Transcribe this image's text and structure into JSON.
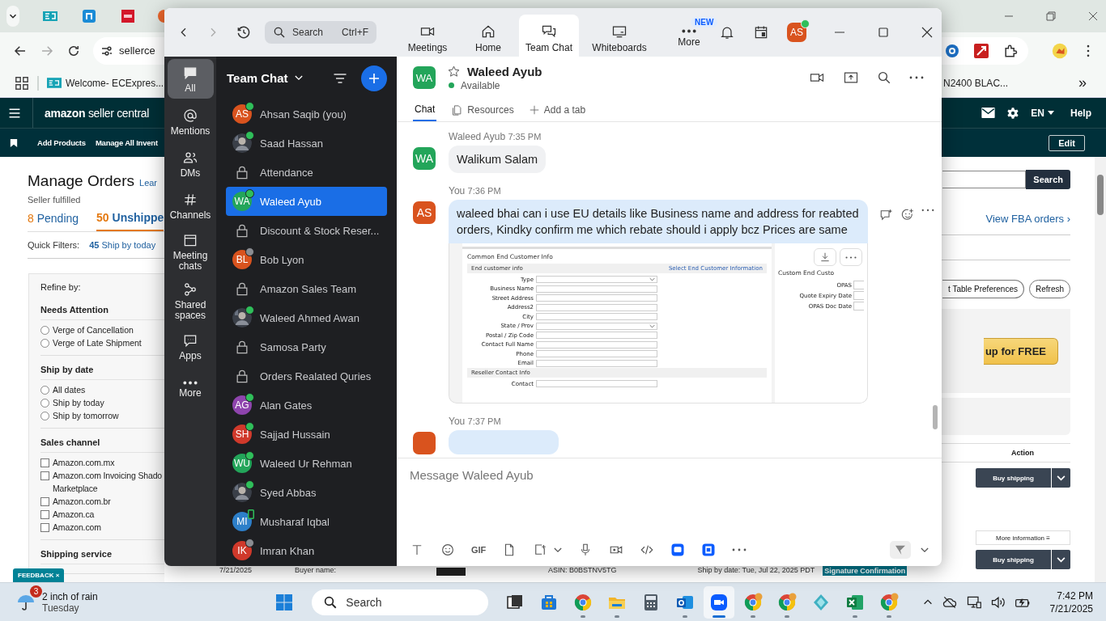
{
  "browser": {
    "address": "sellerce",
    "bookmarks": [
      {
        "label": "Welcome- ECExpres..."
      },
      {
        "label": "N2400 BLAC..."
      }
    ],
    "more_bookmarks": "»"
  },
  "seller_central": {
    "brand": "amazon",
    "product": "seller central",
    "language": "EN",
    "help": "Help",
    "nav": [
      "Add Products",
      "Manage All Invent"
    ],
    "edit": "Edit",
    "title": "Manage Orders",
    "learn": "Lear",
    "subtitle": "Seller fulfilled",
    "status_tabs": [
      {
        "count": "8",
        "label": "Pending",
        "selected": false
      },
      {
        "count": "50",
        "label": "Unshippe",
        "selected": true
      }
    ],
    "quick_filters_label": "Quick Filters:",
    "quick_filters": [
      {
        "count": "45",
        "label": "Ship by today"
      }
    ],
    "refine_title": "Refine by:",
    "refine_groups": [
      {
        "title": "Needs Attention",
        "kind": "radio",
        "options": [
          {
            "label": "Verge of Cancellation",
            "selected": false
          },
          {
            "label": "Verge of Late Shipment",
            "selected": false
          }
        ]
      },
      {
        "title": "Ship by date",
        "kind": "radio",
        "options": [
          {
            "label": "All dates",
            "selected": false
          },
          {
            "label": "Ship by today",
            "selected": false
          },
          {
            "label": "Ship by tomorrow",
            "selected": false
          }
        ]
      },
      {
        "title": "Sales channel",
        "kind": "checkbox",
        "options": [
          {
            "label": "Amazon.com.mx",
            "checked": false
          },
          {
            "label": "Amazon.com Invoicing Shado Marketplace",
            "checked": false
          },
          {
            "label": "Amazon.com.br",
            "checked": false
          },
          {
            "label": "Amazon.ca",
            "checked": false
          },
          {
            "label": "Amazon.com",
            "checked": false
          }
        ]
      },
      {
        "title": "Shipping service",
        "kind": "heading"
      }
    ],
    "search_button": "Search",
    "fba_link": "View FBA orders ›",
    "prefs_button": "t Table Preferences",
    "refresh_button": "Refresh",
    "promo_button": "up for FREE",
    "action_header": "Action",
    "order_actions": [
      {
        "label": "Buy shipping"
      },
      {
        "label": "Buy shipping",
        "more": "More information ≡"
      }
    ],
    "order_row": {
      "date": "7/21/2025",
      "buyer_label": "Buyer name:",
      "asin": "ASIN: B0BSTNV5TG",
      "ship_by": "Ship by date: Tue, Jul 22, 2025 PDT",
      "tag": "Signature Confirmation"
    },
    "feedback": "FEEDBACK ×"
  },
  "zoom": {
    "search": {
      "placeholder": "Search",
      "shortcut": "Ctrl+F"
    },
    "tabs": [
      {
        "label": "Meetings",
        "selected": false
      },
      {
        "label": "Home",
        "selected": false
      },
      {
        "label": "Team Chat",
        "selected": true
      },
      {
        "label": "Whiteboards",
        "selected": false
      },
      {
        "label": "More",
        "selected": false,
        "badge": "NEW"
      }
    ],
    "profile": {
      "initials": "AS",
      "color": "#d9531e",
      "online": true
    },
    "rail": [
      {
        "label": "All",
        "selected": true
      },
      {
        "label": "Mentions",
        "selected": false
      },
      {
        "label": "DMs",
        "selected": false
      },
      {
        "label": "Channels",
        "selected": false
      },
      {
        "label": "Meeting chats",
        "selected": false
      },
      {
        "label": "Shared spaces",
        "selected": false
      },
      {
        "label": "Apps",
        "selected": false
      },
      {
        "label": "More",
        "selected": false
      }
    ],
    "list_title": "Team Chat",
    "chats": [
      {
        "kind": "contact",
        "name": "Ahsan Saqib (you)",
        "initials": "AS",
        "color": "#d9531e",
        "online": true,
        "away": false,
        "mobile": false,
        "selected": false
      },
      {
        "name": "Saad Hassan",
        "online": true,
        "away": false,
        "mobile": false,
        "selected": false
      },
      {
        "kind": "channel",
        "name": "Attendance",
        "online": false,
        "away": false,
        "mobile": false,
        "selected": false
      },
      {
        "kind": "contact",
        "name": "Waleed Ayub",
        "initials": "WA",
        "color": "#23a55a",
        "online": true,
        "away": false,
        "mobile": false,
        "selected": true
      },
      {
        "kind": "channel",
        "name": "Discount & Stock Reser...",
        "online": false,
        "away": false,
        "mobile": false,
        "selected": false
      },
      {
        "kind": "contact",
        "name": "Bob Lyon",
        "initials": "BL",
        "color": "#d9531e",
        "online": false,
        "away": true,
        "mobile": false,
        "selected": false
      },
      {
        "kind": "channel",
        "name": "Amazon Sales Team",
        "online": false,
        "away": false,
        "mobile": false,
        "selected": false
      },
      {
        "name": "Waleed Ahmed Awan",
        "online": true,
        "away": false,
        "mobile": false,
        "selected": false
      },
      {
        "kind": "channel",
        "name": "Samosa Party",
        "online": false,
        "away": false,
        "mobile": false,
        "selected": false
      },
      {
        "kind": "channel",
        "name": "Orders Realated Quries",
        "online": false,
        "away": false,
        "mobile": false,
        "selected": false
      },
      {
        "kind": "contact",
        "name": "Alan Gates",
        "initials": "AG",
        "color": "#8e44ad",
        "online": true,
        "away": false,
        "mobile": false,
        "selected": false
      },
      {
        "kind": "contact",
        "name": "Sajjad Hussain",
        "initials": "SH",
        "color": "#d0392b",
        "online": true,
        "away": false,
        "mobile": false,
        "selected": false
      },
      {
        "kind": "contact",
        "name": "Waleed Ur Rehman",
        "initials": "WU",
        "color": "#23a55a",
        "online": true,
        "away": false,
        "mobile": false,
        "selected": false
      },
      {
        "name": "Syed Abbas",
        "online": true,
        "away": false,
        "mobile": false,
        "selected": false
      },
      {
        "kind": "contact",
        "name": "Musharaf Iqbal",
        "initials": "MI",
        "color": "#2d7fc9",
        "online": false,
        "away": false,
        "mobile": true,
        "selected": false
      },
      {
        "kind": "contact",
        "name": "Imran Khan",
        "initials": "IK",
        "color": "#d0392b",
        "online": false,
        "away": true,
        "mobile": false,
        "selected": false
      }
    ],
    "conversation": {
      "initials": "WA",
      "color": "#23a55a",
      "name": "Waleed Ayub",
      "status": "Available",
      "tabs": [
        {
          "label": "Chat",
          "selected": true
        },
        {
          "label": "Resources",
          "selected": false
        },
        {
          "label": "Add a tab",
          "selected": false
        }
      ],
      "messages": [
        {
          "sender": "Waleed Ayub",
          "time": "7:35 PM",
          "initials": "WA",
          "color": "#23a55a",
          "own": false,
          "text": "Walikum Salam"
        },
        {
          "sender": "You",
          "time": "7:36 PM",
          "initials": "AS",
          "color": "#d9531e",
          "own": true,
          "text": "waleed bhai can i use EU details like Business name and address for reabted orders, Kindky confirm me which rebate should i apply bcz Prices are same",
          "attachment": {
            "section": "Common End Customer Info",
            "subsection": "End customer info",
            "link": "Select End Customer Information",
            "fields": [
              {
                "label": "Type",
                "kind": "select"
              },
              {
                "label": "Business Name",
                "kind": "text"
              },
              {
                "label": "Street Address",
                "kind": "text"
              },
              {
                "label": "Address2",
                "kind": "text"
              },
              {
                "label": "City",
                "kind": "text"
              },
              {
                "label": "State / Prov",
                "kind": "select"
              },
              {
                "label": "Postal / Zip Code",
                "kind": "text"
              },
              {
                "label": "Contact Full Name",
                "kind": "text"
              },
              {
                "label": "Phone",
                "kind": "text"
              },
              {
                "label": "Email",
                "kind": "text"
              }
            ],
            "reseller_section": "Reseller Contact Info",
            "contact_label": "Contact",
            "side_title": "Custom End Custo",
            "side_fields": [
              "OPAS",
              "Quote Expiry Date",
              "OPAS Doc Date"
            ]
          }
        },
        {
          "sender": "You",
          "time": "7:37 PM",
          "color": "#d9531e",
          "own": true
        }
      ]
    },
    "composer": {
      "placeholder": "Message Waleed Ayub",
      "gif": "GIF"
    }
  },
  "taskbar": {
    "weather": {
      "badge": "3",
      "title": "2 inch of rain",
      "subtitle": "Tuesday"
    },
    "search": "Search",
    "apps": [
      {
        "running": false,
        "selected": false
      },
      {
        "running": false,
        "selected": false
      },
      {
        "running": true,
        "selected": false
      },
      {
        "running": true,
        "selected": false
      },
      {
        "running": false,
        "selected": false
      },
      {
        "running": true,
        "selected": false
      },
      {
        "running": true,
        "selected": true
      },
      {
        "running": true,
        "selected": false
      },
      {
        "running": true,
        "selected": false
      },
      {
        "running": false,
        "selected": false
      },
      {
        "running": true,
        "selected": false
      },
      {
        "running": true,
        "selected": false
      }
    ],
    "time": "7:42 PM",
    "date": "7/21/2025"
  }
}
